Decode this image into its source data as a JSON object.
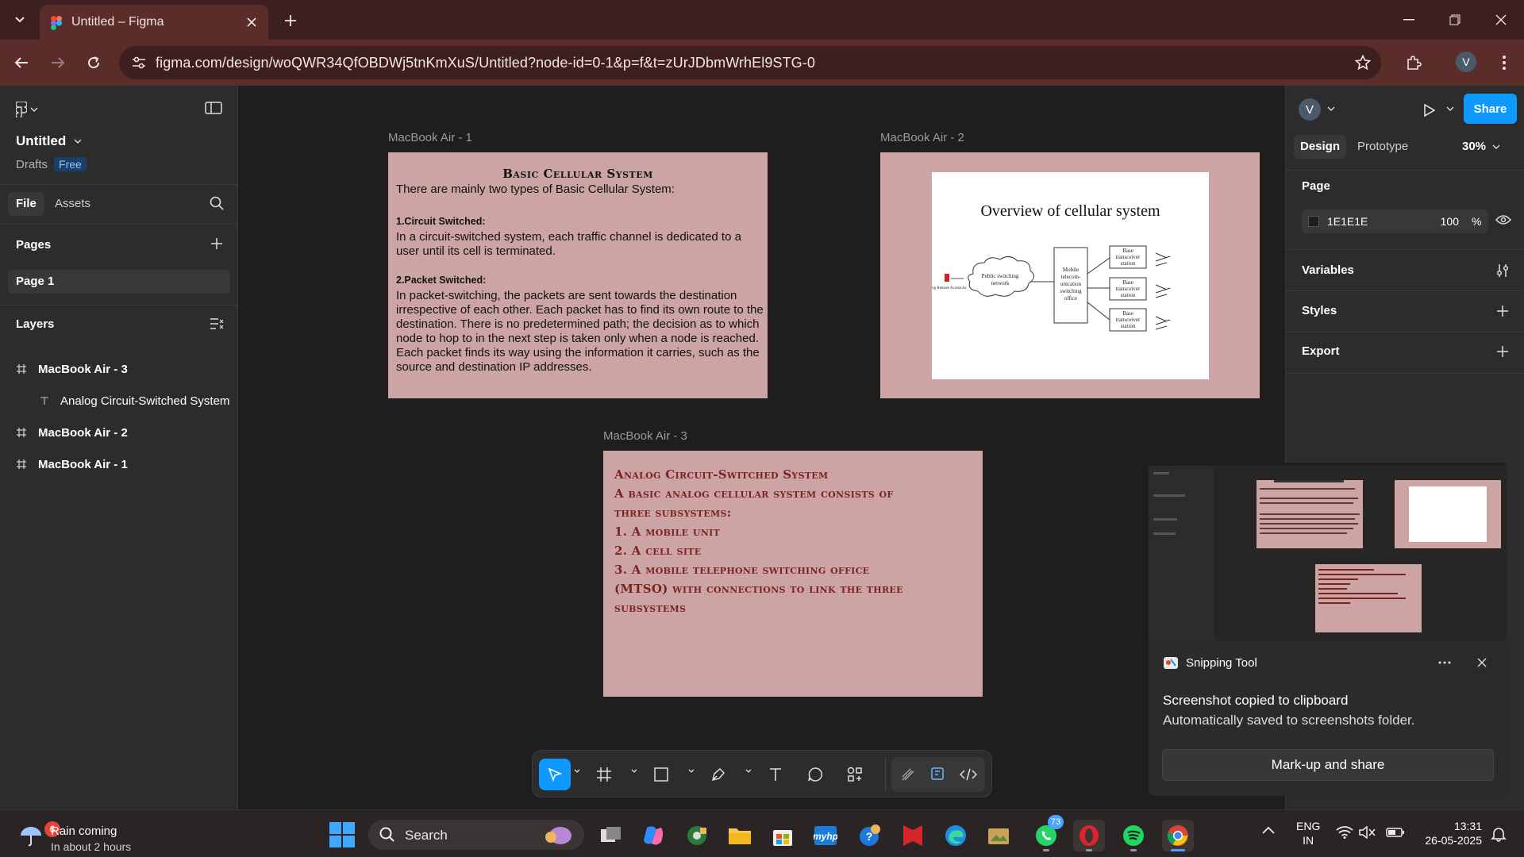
{
  "browser": {
    "tab_title": "Untitled – Figma",
    "url": "figma.com/design/woQWR34QfOBDWj5tnKmXuS/Untitled?node-id=0-1&p=f&t=zUrJDbmWrhEl9STG-0",
    "profile_initial": "V"
  },
  "left_panel": {
    "file_name": "Untitled",
    "location": "Drafts",
    "plan": "Free",
    "tabs": [
      "File",
      "Assets"
    ],
    "pages_heading": "Pages",
    "pages": [
      "Page 1"
    ],
    "layers_heading": "Layers",
    "layers": [
      {
        "name": "MacBook Air - 3",
        "type": "frame-icon"
      },
      {
        "name": "Analog Circuit-Switched System",
        "type": "text-icon"
      },
      {
        "name": "MacBook Air - 2",
        "type": "frame-icon"
      },
      {
        "name": "MacBook Air - 1",
        "type": "frame-icon"
      }
    ]
  },
  "canvas": {
    "frame1": {
      "label": "MacBook Air - 1",
      "heading": "Basic Cellular System",
      "intro": "There are mainly two types of Basic Cellular System:",
      "h1": "1.Circuit Switched:",
      "p1": "In a circuit-switched system, each traffic channel is dedicated to  a user until its cell is terminated.",
      "h2": "2.Packet Switched:",
      "p2": "In packet-switching, the packets are sent towards the destination irrespective of each other. Each packet has to find its own route to the destination. There is no predetermined path; the decision as to which node to hop to in the next step is taken only when a node is reached. Each packet finds its way using the information it carries, such as the source and destination IP addresses."
    },
    "frame2": {
      "label": "MacBook Air - 2",
      "diagram_title": "Overview of cellular system",
      "cloud_label_1": "Public switching",
      "cloud_label_2": "network",
      "left_label": "ng Remote Access Ac",
      "mtso_lines": [
        "Mobile",
        "telecom-",
        "unication",
        "switching",
        "office"
      ],
      "station_lines": [
        "Base",
        "transceiver",
        "station"
      ]
    },
    "frame3": {
      "label": "MacBook Air - 3",
      "lines": [
        "Analog Circuit-Switched System",
        "A basic analog cellular system consists of",
        "three subsystems:",
        "1. A mobile unit",
        "2. A cell site",
        "3. A mobile telephone switching office",
        "(MTSO) with connections to link the three",
        "subsystems"
      ]
    }
  },
  "right_panel": {
    "avatar_initial": "V",
    "share_label": "Share",
    "tabs": [
      "Design",
      "Prototype"
    ],
    "zoom": "30%",
    "page_heading": "Page",
    "page_color": "1E1E1E",
    "page_opacity": "100",
    "opacity_unit": "%",
    "sections": [
      "Variables",
      "Styles",
      "Export"
    ]
  },
  "snipping_tool": {
    "app_name": "Snipping Tool",
    "title": "Screenshot copied to clipboard",
    "body": "Automatically saved to screenshots folder.",
    "action_label": "Mark-up and share"
  },
  "taskbar": {
    "weather_badge": "6",
    "weather_title": "Rain coming",
    "weather_sub": "In about 2 hours",
    "search_label": "Search",
    "whatsapp_badge": "73",
    "lang_line1": "ENG",
    "lang_line2": "IN",
    "time": "13:31",
    "date": "26-05-2025"
  },
  "colors": {
    "figma_blue": "#0d99ff",
    "frame_pink": "#cda4a4",
    "frame3_text": "#7a2420",
    "browser_chrome": "#5a2d2b"
  }
}
